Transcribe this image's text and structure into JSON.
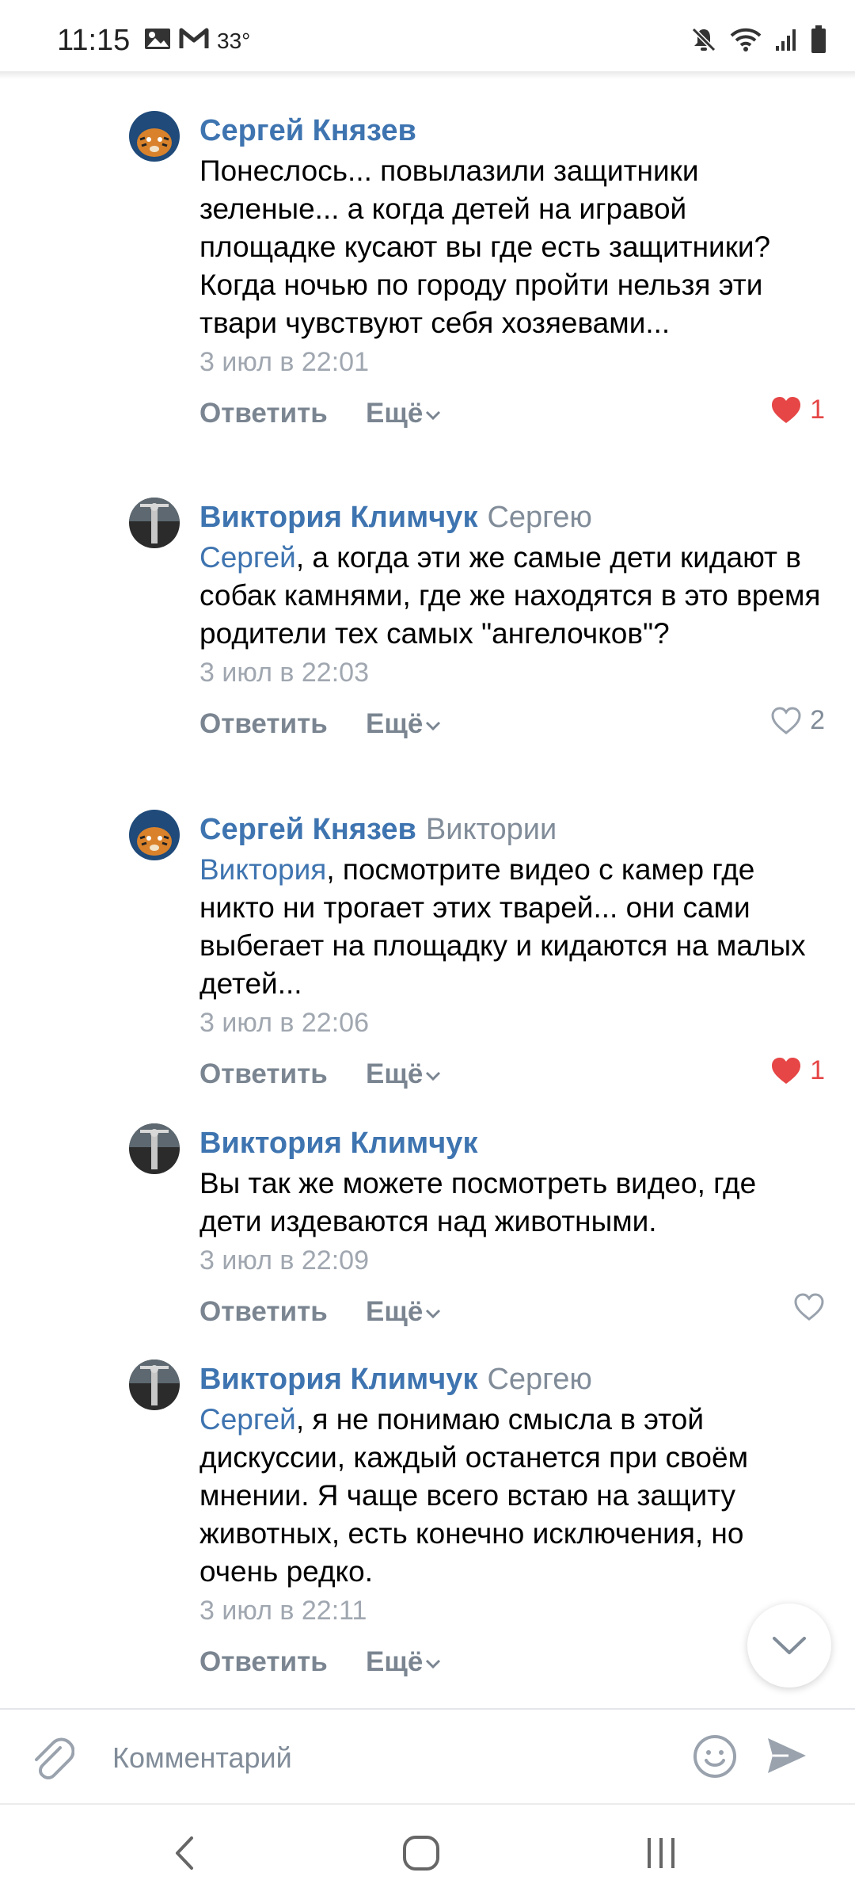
{
  "status_bar": {
    "time": "11:15",
    "temperature": "33°",
    "left_icons": [
      "image-icon",
      "gmail-icon"
    ],
    "right_icons": [
      "mute-icon",
      "wifi-icon",
      "signal-icon",
      "battery-icon"
    ]
  },
  "comments": [
    {
      "author": "Сергей Князев",
      "reply_to": "",
      "mention": "",
      "text": "Понеслось... повылазили защитники зеленые... а когда детей на игравой площадке кусают вы где есть защитники? Когда ночью по городу пройти нельзя эти твари чувствуют себя хозяевами...",
      "date": "3 июл в 22:01",
      "reply_label": "Ответить",
      "more_label": "Ещё",
      "likes": "1",
      "liked": true,
      "avatar": "tiger"
    },
    {
      "author": "Виктория Климчук",
      "reply_to": "Сергею",
      "mention": "Сергей",
      "text": ", а когда эти же самые дети кидают в собак камнями, где же находятся в это время родители тех самых \"ангелочков\"?",
      "date": "3 июл в 22:03",
      "reply_label": "Ответить",
      "more_label": "Ещё",
      "likes": "2",
      "liked": false,
      "avatar": "statue"
    },
    {
      "author": "Сергей Князев",
      "reply_to": "Виктории",
      "mention": "Виктория",
      "text": ", посмотрите видео с камер где никто ни трогает этих тварей... они сами выбегает на площадку и кидаются на малых детей...",
      "date": "3 июл в 22:06",
      "reply_label": "Ответить",
      "more_label": "Ещё",
      "likes": "1",
      "liked": true,
      "avatar": "tiger"
    },
    {
      "author": "Виктория Климчук",
      "reply_to": "",
      "mention": "",
      "text": "Вы так же можете посмотреть видео, где дети издеваются над животными.",
      "date": "3 июл в 22:09",
      "reply_label": "Ответить",
      "more_label": "Ещё",
      "likes": "",
      "liked": false,
      "avatar": "statue"
    },
    {
      "author": "Виктория Климчук",
      "reply_to": "Сергею",
      "mention": "Сергей",
      "text": ", я не понимаю смысла в этой дискуссии, каждый останется при своём мнении. Я чаще всего встаю на защиту животных, есть конечно исключения, но очень редко.",
      "date": "3 июл в 22:11",
      "reply_label": "Ответить",
      "more_label": "Ещё",
      "likes": "",
      "liked": null,
      "avatar": "statue"
    }
  ],
  "composer": {
    "placeholder": "Комментарий",
    "value": ""
  },
  "colors": {
    "link_blue": "#3e74b0",
    "meta_grey": "#818c99",
    "like_red": "#e64646"
  }
}
